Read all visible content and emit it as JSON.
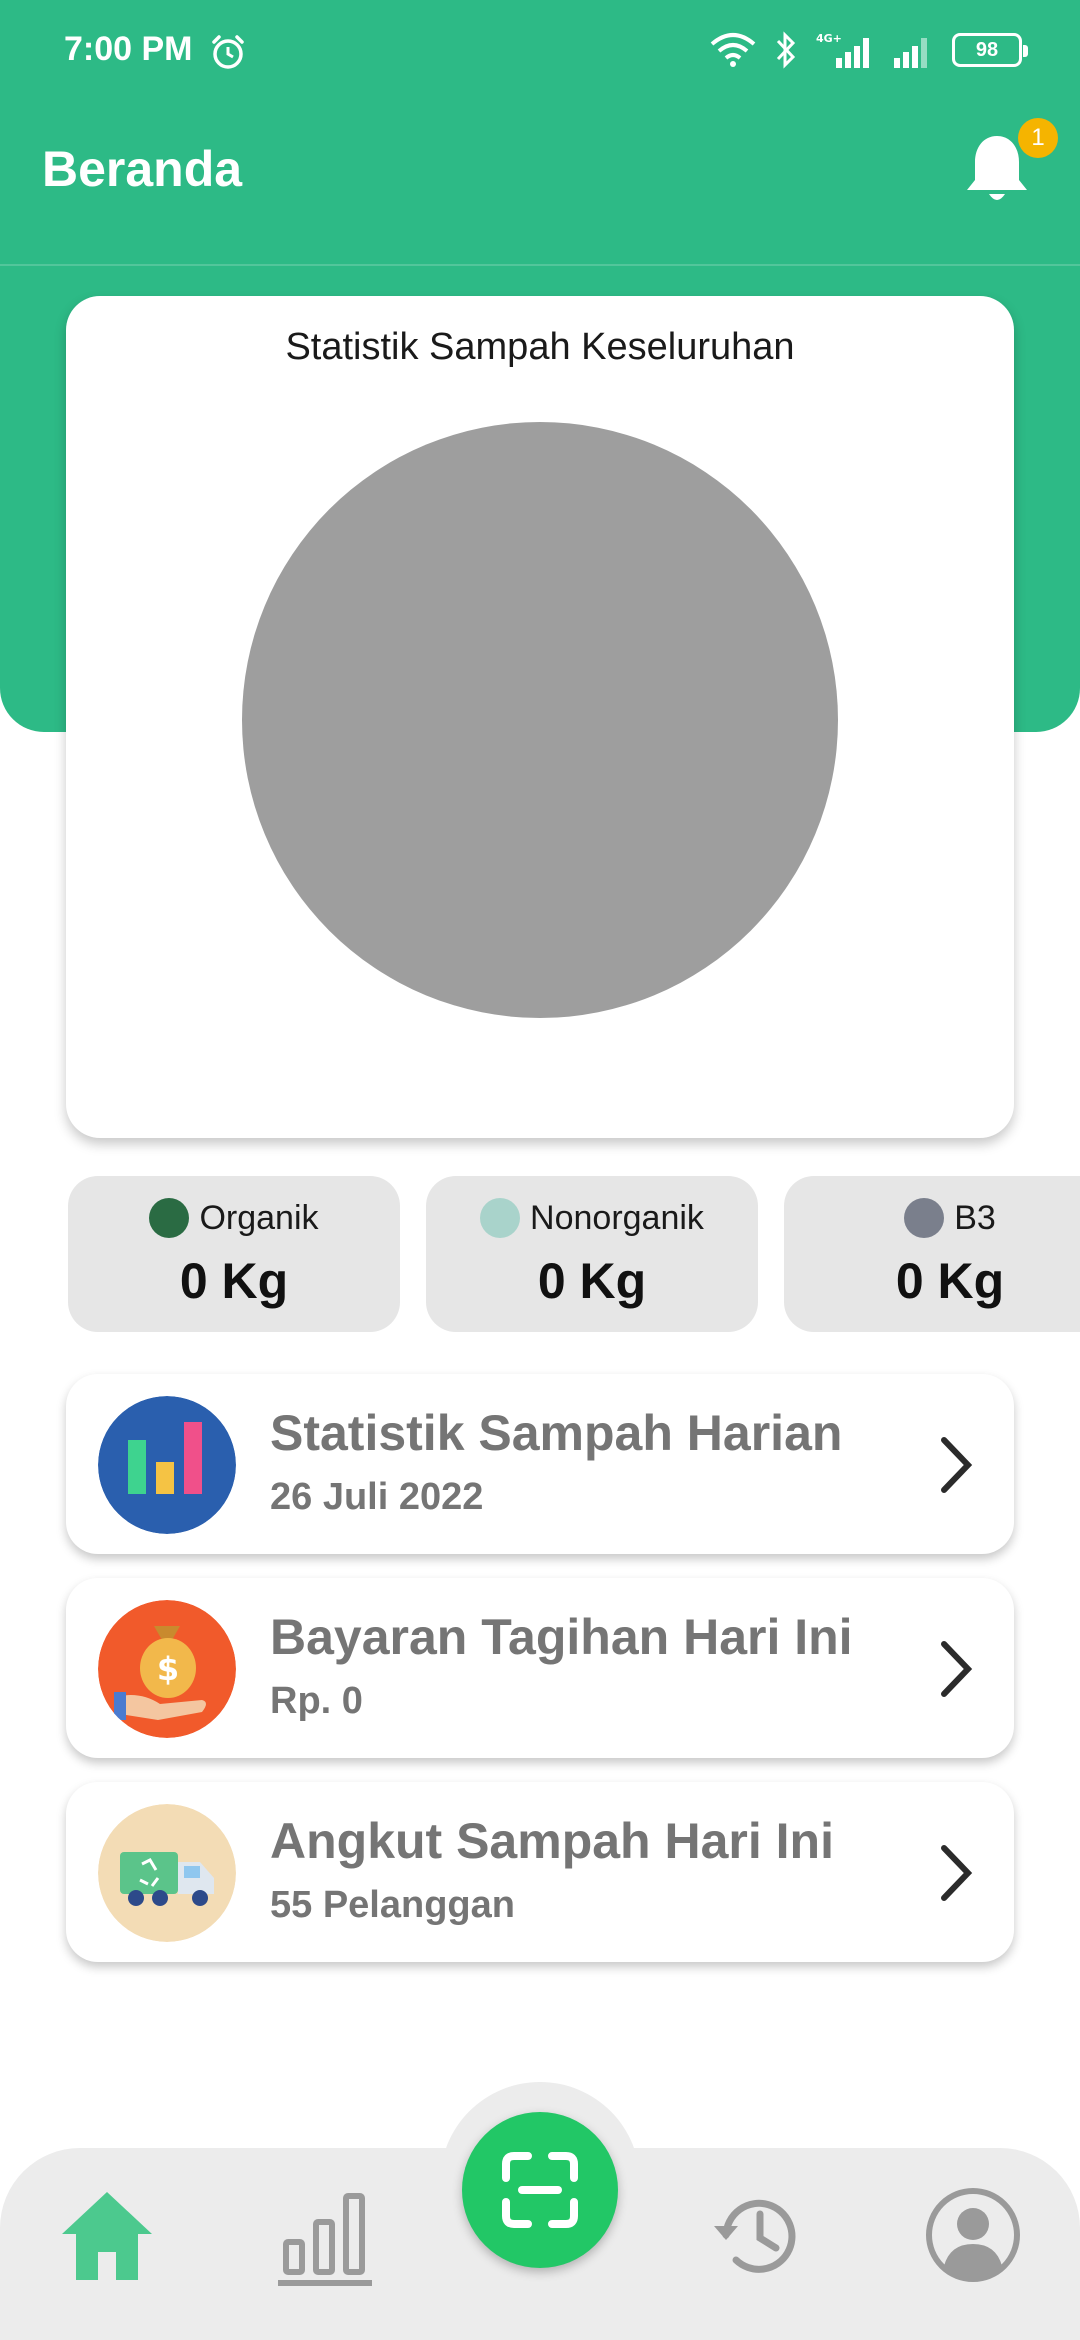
{
  "status_bar": {
    "time": "7:00 PM",
    "battery": "98",
    "network": "4G+"
  },
  "app_bar": {
    "title": "Beranda",
    "notification_count": "1"
  },
  "stats_card": {
    "title": "Statistik Sampah Keseluruhan"
  },
  "chart_data": {
    "type": "pie",
    "title": "Statistik Sampah Keseluruhan",
    "categories": [
      "Organik",
      "Nonorganik",
      "B3"
    ],
    "values": [
      0,
      0,
      0
    ],
    "unit": "Kg",
    "empty_fill_color": "#9e9e9e"
  },
  "categories": [
    {
      "label": "Organik",
      "value": "0 Kg",
      "color": "#2a6b43"
    },
    {
      "label": "Nonorganik",
      "value": "0 Kg",
      "color": "#a9d3cb"
    },
    {
      "label": "B3",
      "value": "0 Kg",
      "color": "#7a7f8c"
    }
  ],
  "list": [
    {
      "title": "Statistik Sampah Harian",
      "subtitle": "26 Juli 2022",
      "icon": "bar-chart-icon"
    },
    {
      "title": "Bayaran Tagihan Hari Ini",
      "subtitle": "Rp. 0",
      "icon": "money-bag-icon"
    },
    {
      "title": "Angkut Sampah Hari Ini",
      "subtitle": "55 Pelanggan",
      "icon": "garbage-truck-icon"
    }
  ],
  "bottom_nav": {
    "items": [
      "home-icon",
      "statistics-icon",
      "scan-icon",
      "history-icon",
      "profile-icon"
    ],
    "active": "home-icon"
  },
  "colors": {
    "primary": "#2dba86",
    "fab": "#22c766",
    "badge": "#f5b400"
  }
}
